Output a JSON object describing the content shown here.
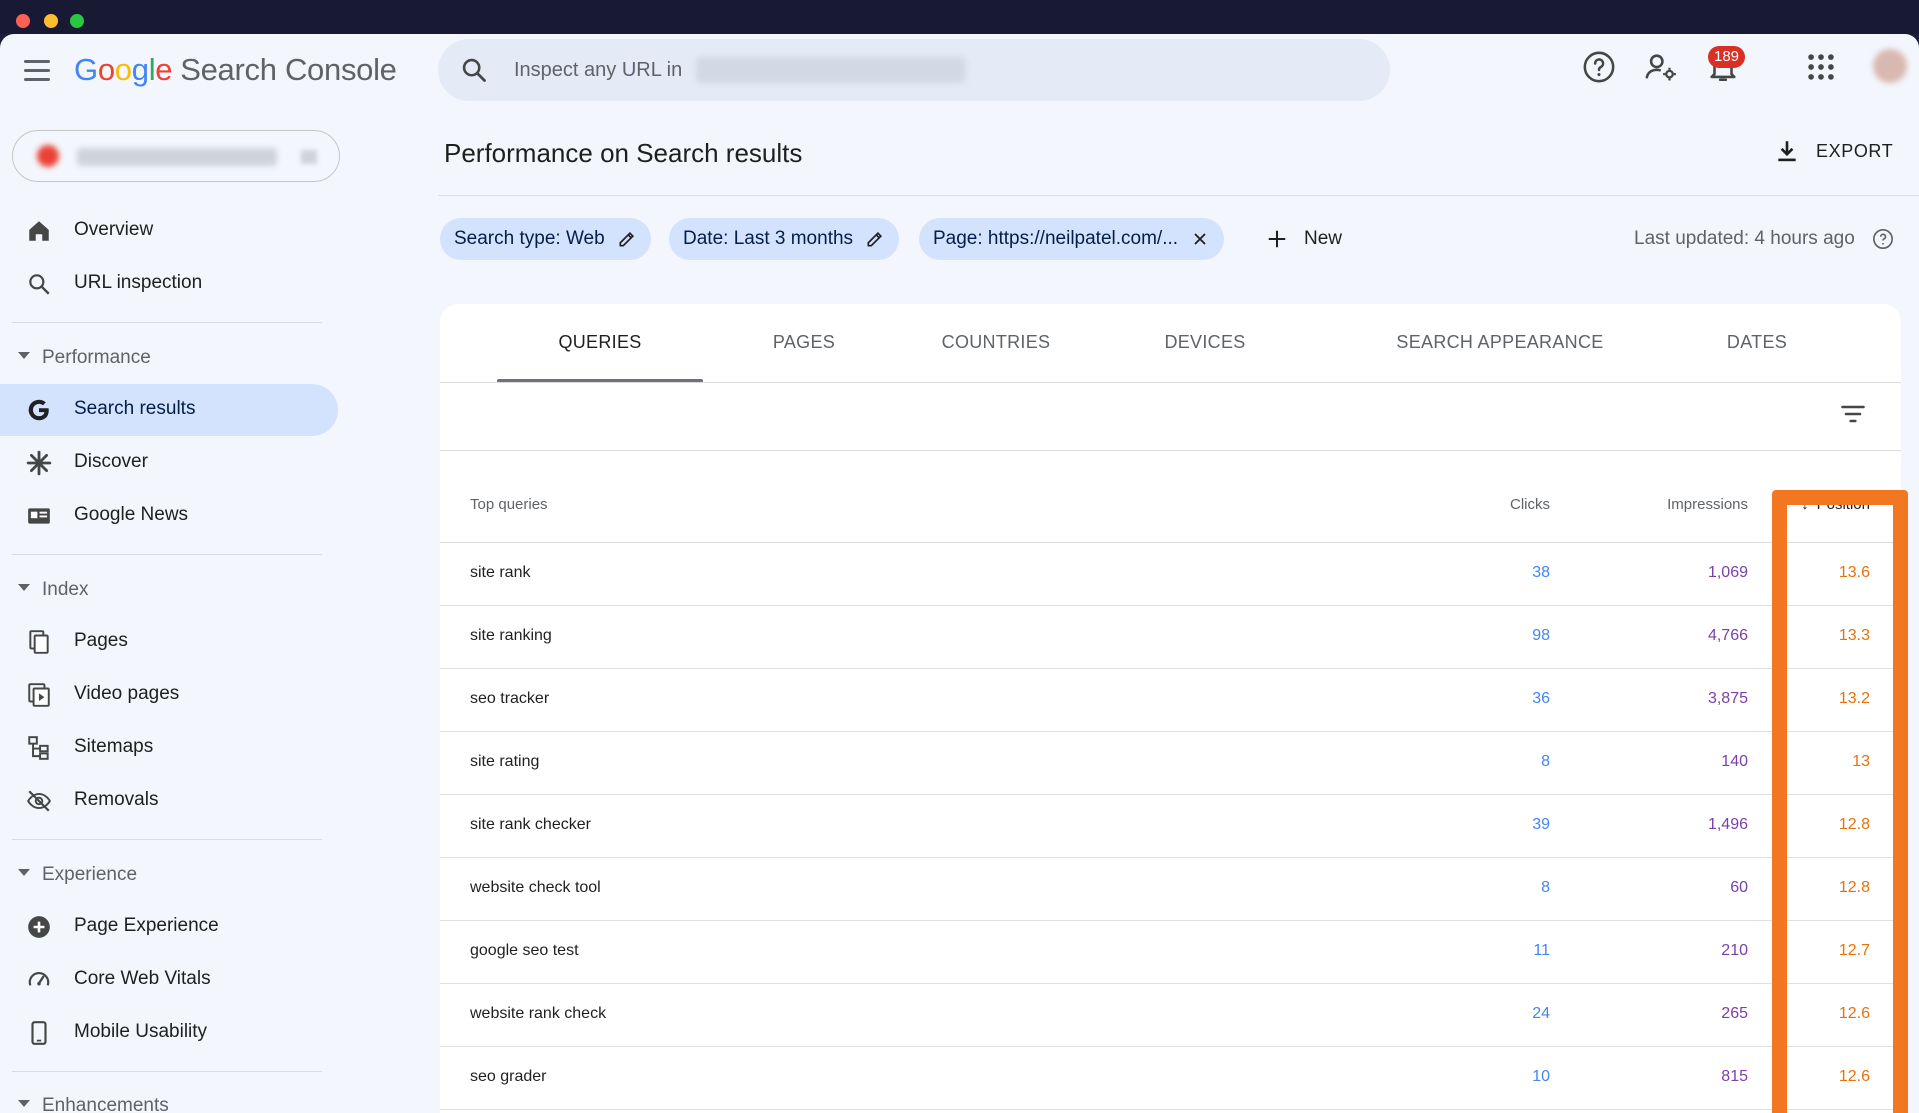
{
  "window": {
    "controls": [
      "close",
      "minimize",
      "maximize"
    ]
  },
  "header": {
    "logo_google": [
      "G",
      "o",
      "o",
      "g",
      "l",
      "e"
    ],
    "app_name": "Search Console",
    "search_placeholder": "Inspect any URL in",
    "notification_count": "189",
    "icons": [
      "menu-icon",
      "search-icon",
      "help-icon",
      "manage-users-icon",
      "bell-icon",
      "apps-grid-icon",
      "avatar"
    ]
  },
  "sidebar": {
    "top_items": [
      {
        "label": "Overview",
        "icon": "home-icon"
      },
      {
        "label": "URL inspection",
        "icon": "search-icon"
      }
    ],
    "sections": [
      {
        "title": "Performance",
        "items": [
          {
            "label": "Search results",
            "icon": "google-g-icon",
            "active": true
          },
          {
            "label": "Discover",
            "icon": "asterisk-icon"
          },
          {
            "label": "Google News",
            "icon": "news-icon"
          }
        ]
      },
      {
        "title": "Index",
        "items": [
          {
            "label": "Pages",
            "icon": "pages-icon"
          },
          {
            "label": "Video pages",
            "icon": "video-pages-icon"
          },
          {
            "label": "Sitemaps",
            "icon": "sitemap-icon"
          },
          {
            "label": "Removals",
            "icon": "eye-off-icon"
          }
        ]
      },
      {
        "title": "Experience",
        "items": [
          {
            "label": "Page Experience",
            "icon": "plus-circle-icon"
          },
          {
            "label": "Core Web Vitals",
            "icon": "gauge-icon"
          },
          {
            "label": "Mobile Usability",
            "icon": "phone-icon"
          }
        ]
      },
      {
        "title": "Enhancements",
        "items": []
      }
    ]
  },
  "main": {
    "title": "Performance on Search results",
    "export_label": "EXPORT",
    "filters": [
      {
        "label": "Search type: Web",
        "icon": "edit-icon"
      },
      {
        "label": "Date: Last 3 months",
        "icon": "edit-icon"
      },
      {
        "label": "Page: https://neilpatel.com/...",
        "icon": "close-icon"
      }
    ],
    "new_label": "New",
    "last_updated": "Last updated: 4 hours ago",
    "tabs": [
      {
        "label": "QUERIES",
        "active": true
      },
      {
        "label": "PAGES"
      },
      {
        "label": "COUNTRIES"
      },
      {
        "label": "DEVICES"
      },
      {
        "label": "SEARCH APPEARANCE"
      },
      {
        "label": "DATES"
      }
    ],
    "table": {
      "headers": {
        "query": "Top queries",
        "clicks": "Clicks",
        "impressions": "Impressions",
        "position": "Position"
      },
      "rows": [
        {
          "query": "site rank",
          "clicks": "38",
          "impressions": "1,069",
          "position": "13.6"
        },
        {
          "query": "site ranking",
          "clicks": "98",
          "impressions": "4,766",
          "position": "13.3"
        },
        {
          "query": "seo tracker",
          "clicks": "36",
          "impressions": "3,875",
          "position": "13.2"
        },
        {
          "query": "site rating",
          "clicks": "8",
          "impressions": "140",
          "position": "13"
        },
        {
          "query": "site rank checker",
          "clicks": "39",
          "impressions": "1,496",
          "position": "12.8"
        },
        {
          "query": "website check tool",
          "clicks": "8",
          "impressions": "60",
          "position": "12.8"
        },
        {
          "query": "google seo test",
          "clicks": "11",
          "impressions": "210",
          "position": "12.7"
        },
        {
          "query": "website rank check",
          "clicks": "24",
          "impressions": "265",
          "position": "12.6"
        },
        {
          "query": "seo grader",
          "clicks": "10",
          "impressions": "815",
          "position": "12.6"
        }
      ]
    }
  },
  "colors": {
    "accent_blue": "#4285f4",
    "impressions_purple": "#7b3fa8",
    "position_orange": "#e8710a",
    "highlight_orange": "#f37621",
    "active_nav_bg": "#d3e3fd"
  }
}
